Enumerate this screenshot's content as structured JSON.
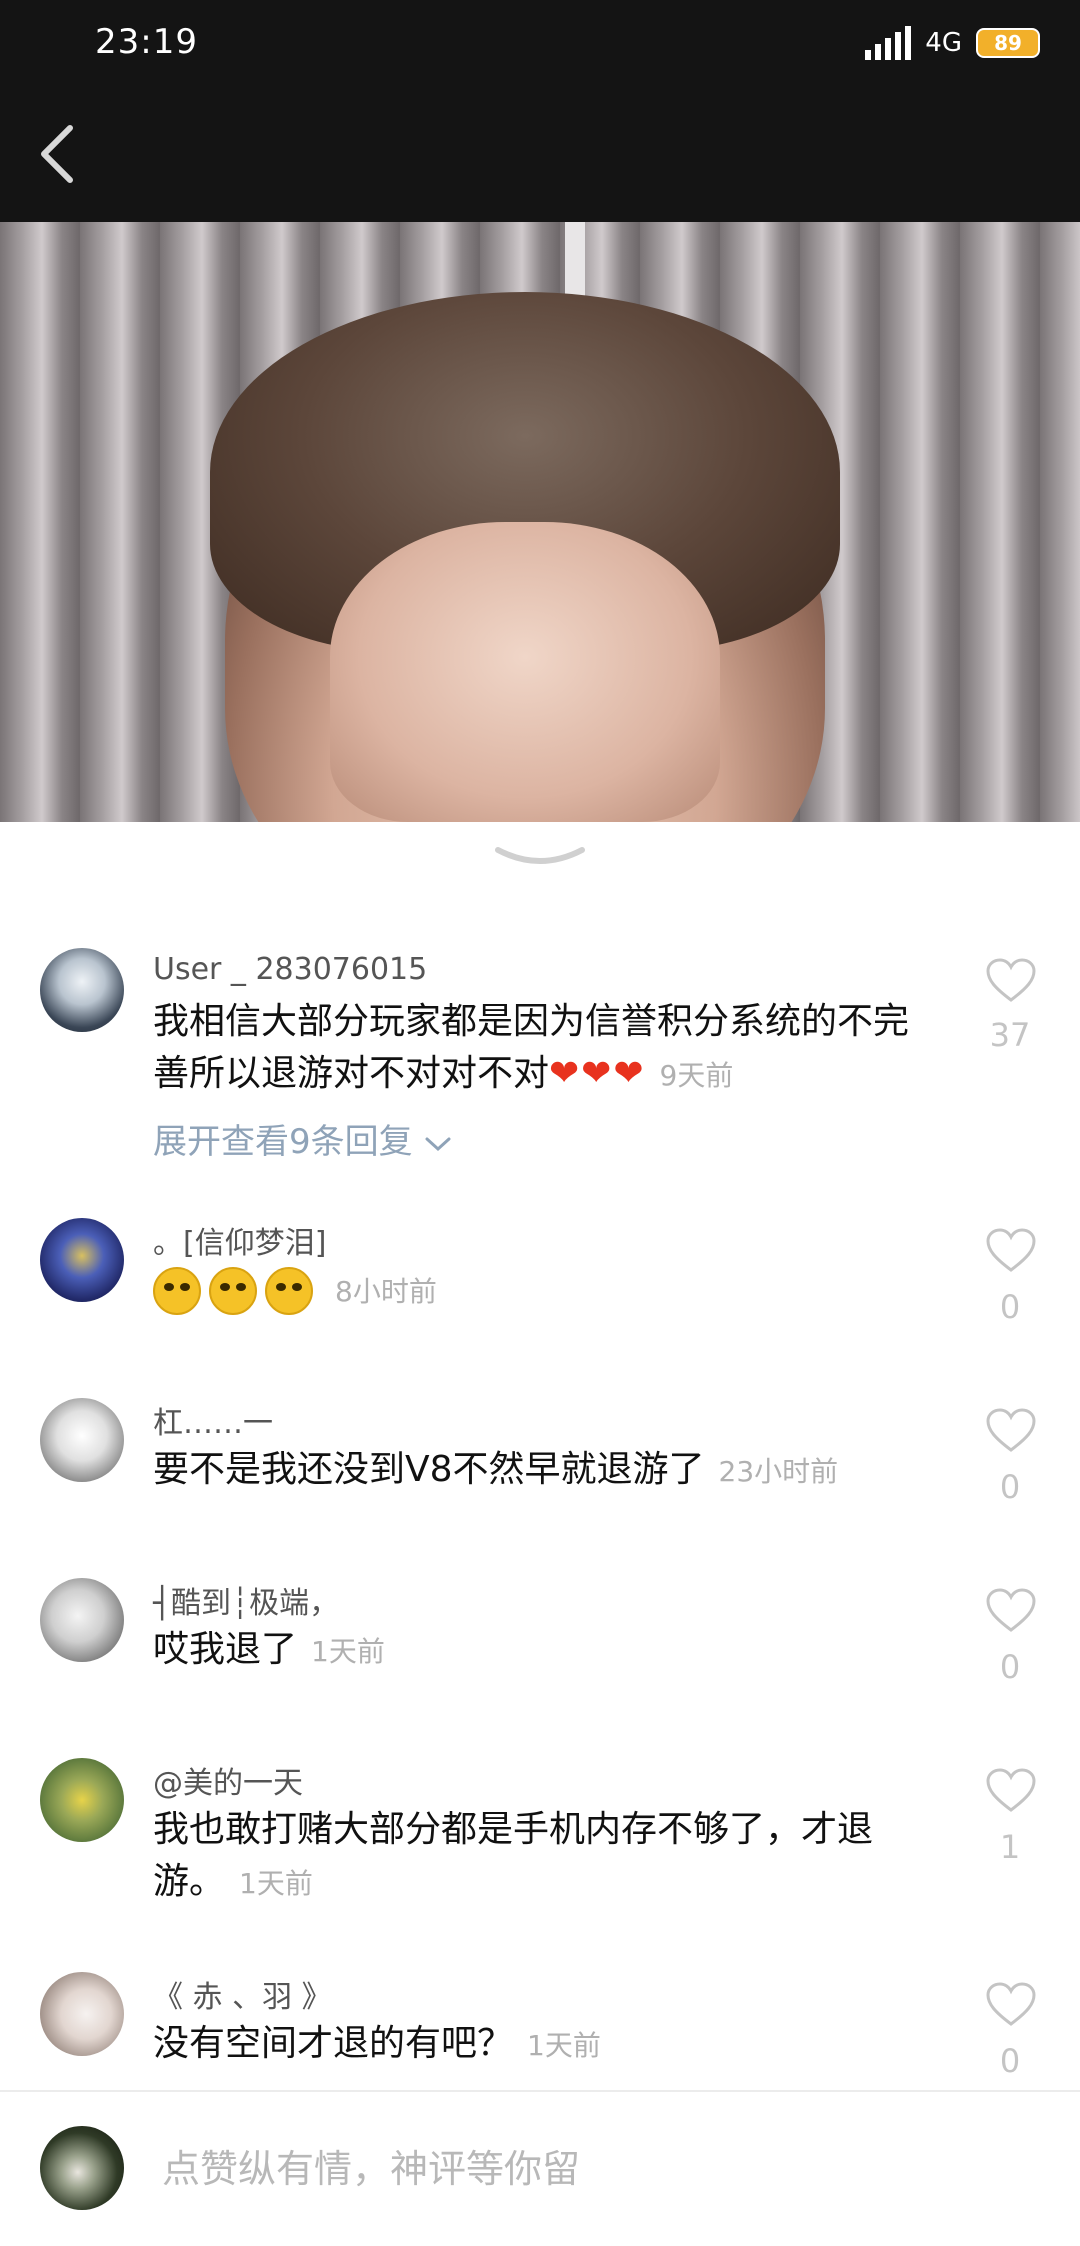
{
  "status_bar": {
    "time": "23:19",
    "network": "4G",
    "battery": "89"
  },
  "video": {
    "accent": "#141414"
  },
  "comments": [
    {
      "username": "User _ 283076015",
      "text": "我相信大部分玩家都是因为信誉积分系统的不完善所以退游对不对对不对",
      "emoji_hearts": "❤❤❤",
      "timestamp": "9天前",
      "expand_label": "展开查看9条回复",
      "likes": "37"
    },
    {
      "username": "。[信仰梦泪]",
      "text": "",
      "emoji_count": 3,
      "timestamp": "8小时前",
      "likes": "0"
    },
    {
      "username": "杠……一",
      "text": "要不是我还没到V8不然早就退游了",
      "timestamp": "23小时前",
      "likes": "0"
    },
    {
      "username": "┤酷到┆极端，",
      "text": "哎我退了",
      "timestamp": "1天前",
      "likes": "0"
    },
    {
      "username": "@美的一天",
      "text": "我也敢打赌大部分都是手机内存不够了，才退游。",
      "timestamp": "1天前",
      "likes": "1"
    },
    {
      "username": "《 赤 、羽 》",
      "text": "没有空间才退的有吧？",
      "timestamp": "1天前",
      "likes": "0"
    }
  ],
  "input": {
    "placeholder": "点赞纵有情，神评等你留"
  },
  "icons": {
    "back": "chevron-left-icon",
    "collapse": "chevron-down-icon",
    "like": "heart-outline-icon"
  }
}
